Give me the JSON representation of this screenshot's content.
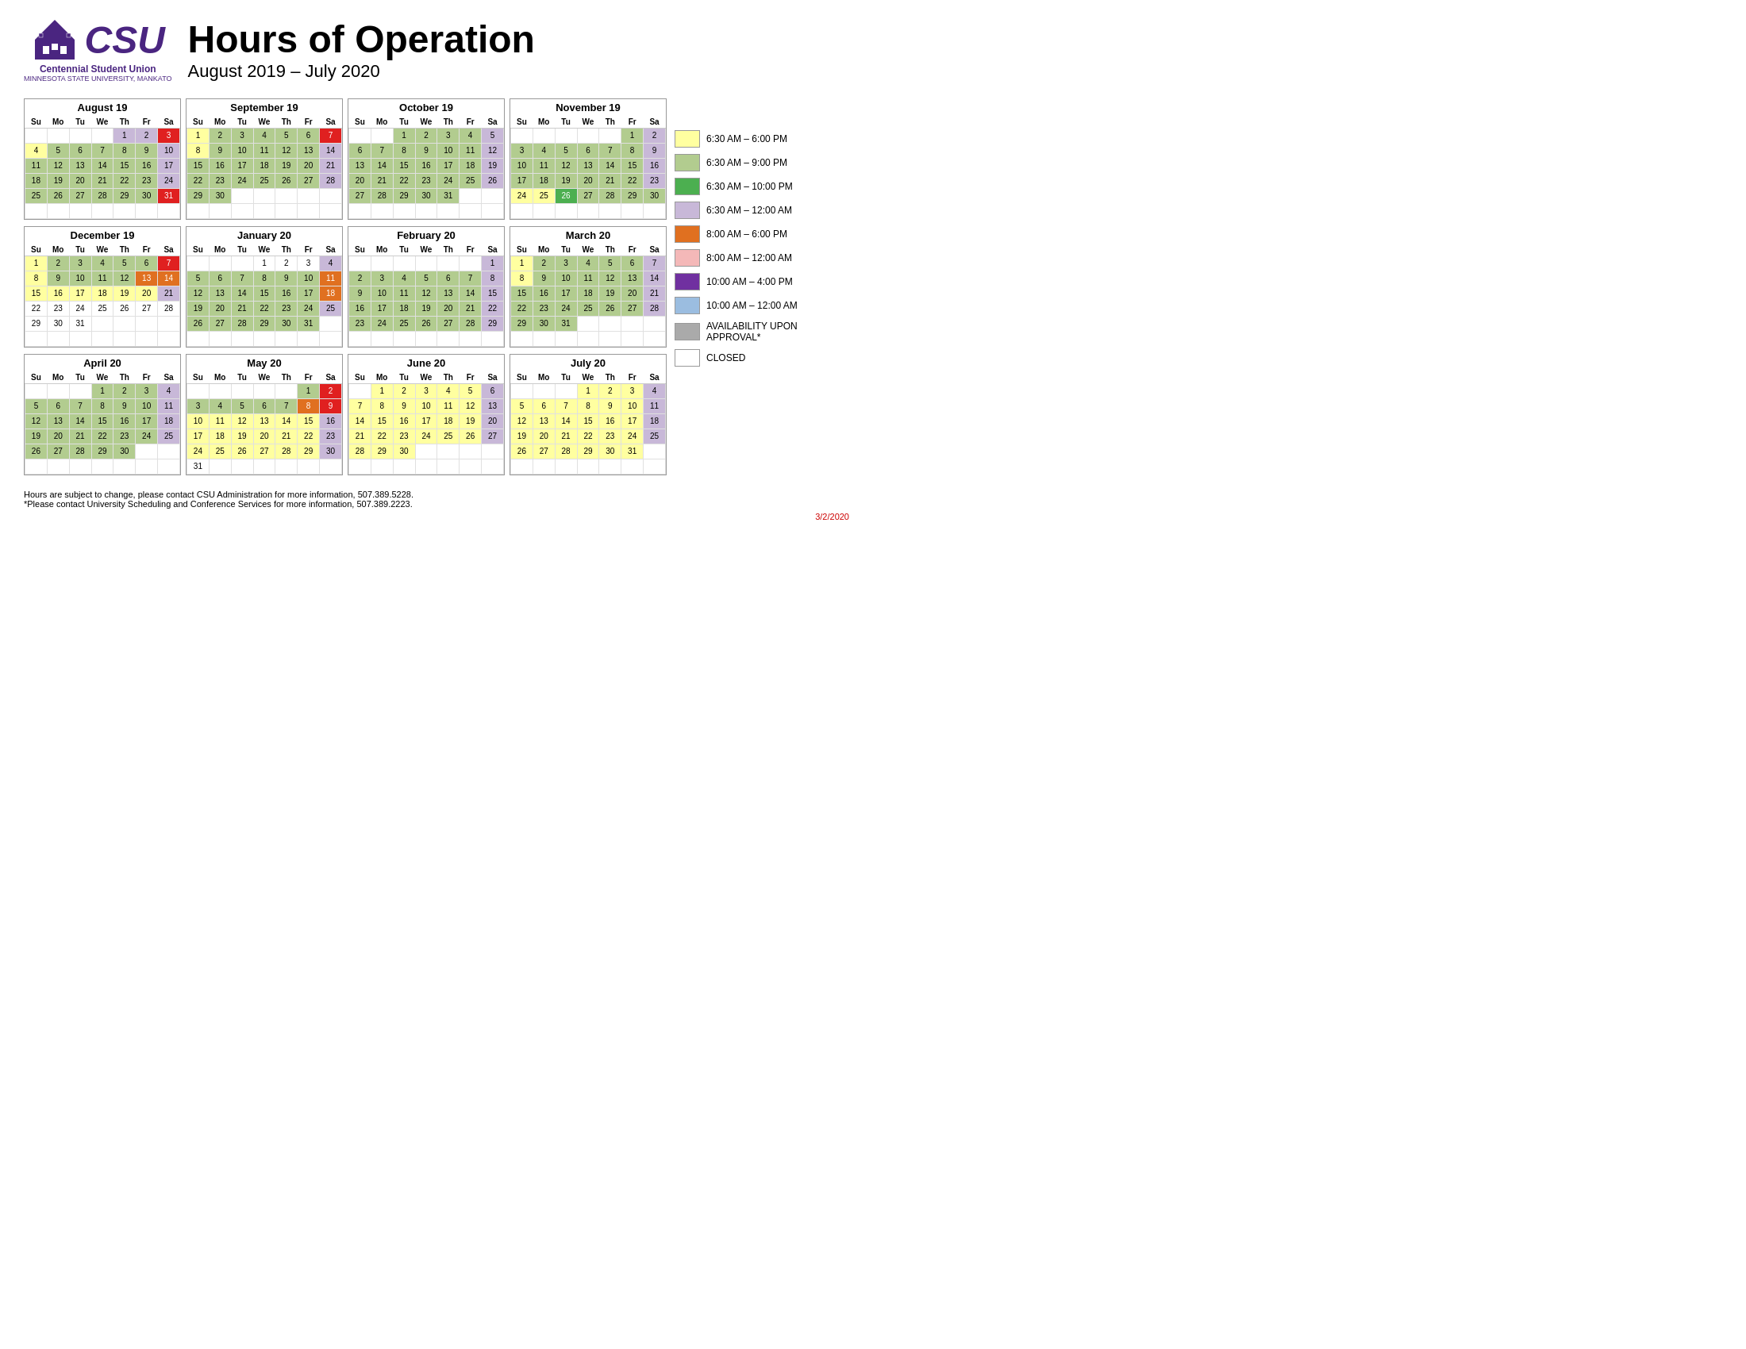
{
  "header": {
    "title": "Hours of Operation",
    "subtitle": "August 2019 – July 2020",
    "org_name": "Centennial Student Union",
    "org_sub": "MINNESOTA STATE UNIVERSITY, MANKATO"
  },
  "legend": [
    {
      "color": "#ffffa0",
      "label": "6:30 AM – 6:00 PM"
    },
    {
      "color": "#b2cc8f",
      "label": "6:30 AM – 9:00 PM"
    },
    {
      "color": "#4caf50",
      "label": "6:30 AM – 10:00 PM"
    },
    {
      "color": "#c8b8d8",
      "label": "6:30 AM – 12:00 AM"
    },
    {
      "color": "#e07020",
      "label": "8:00 AM – 6:00 PM"
    },
    {
      "color": "#f4b8b8",
      "label": "8:00 AM – 12:00 AM"
    },
    {
      "color": "#7030a0",
      "label": "10:00 AM – 4:00 PM"
    },
    {
      "color": "#9bbde0",
      "label": "10:00 AM – 12:00 AM"
    },
    {
      "color": "#aaaaaa",
      "label": "AVAILABILITY UPON APPROVAL*"
    },
    {
      "color": "#ffffff",
      "label": "CLOSED"
    }
  ],
  "footer": {
    "note1": "Hours are subject to change, please contact CSU Administration for more information, 507.389.5228.",
    "note2": "*Please contact University Scheduling and Conference Services for more information, 507.389.2223.",
    "date": "3/2/2020"
  }
}
